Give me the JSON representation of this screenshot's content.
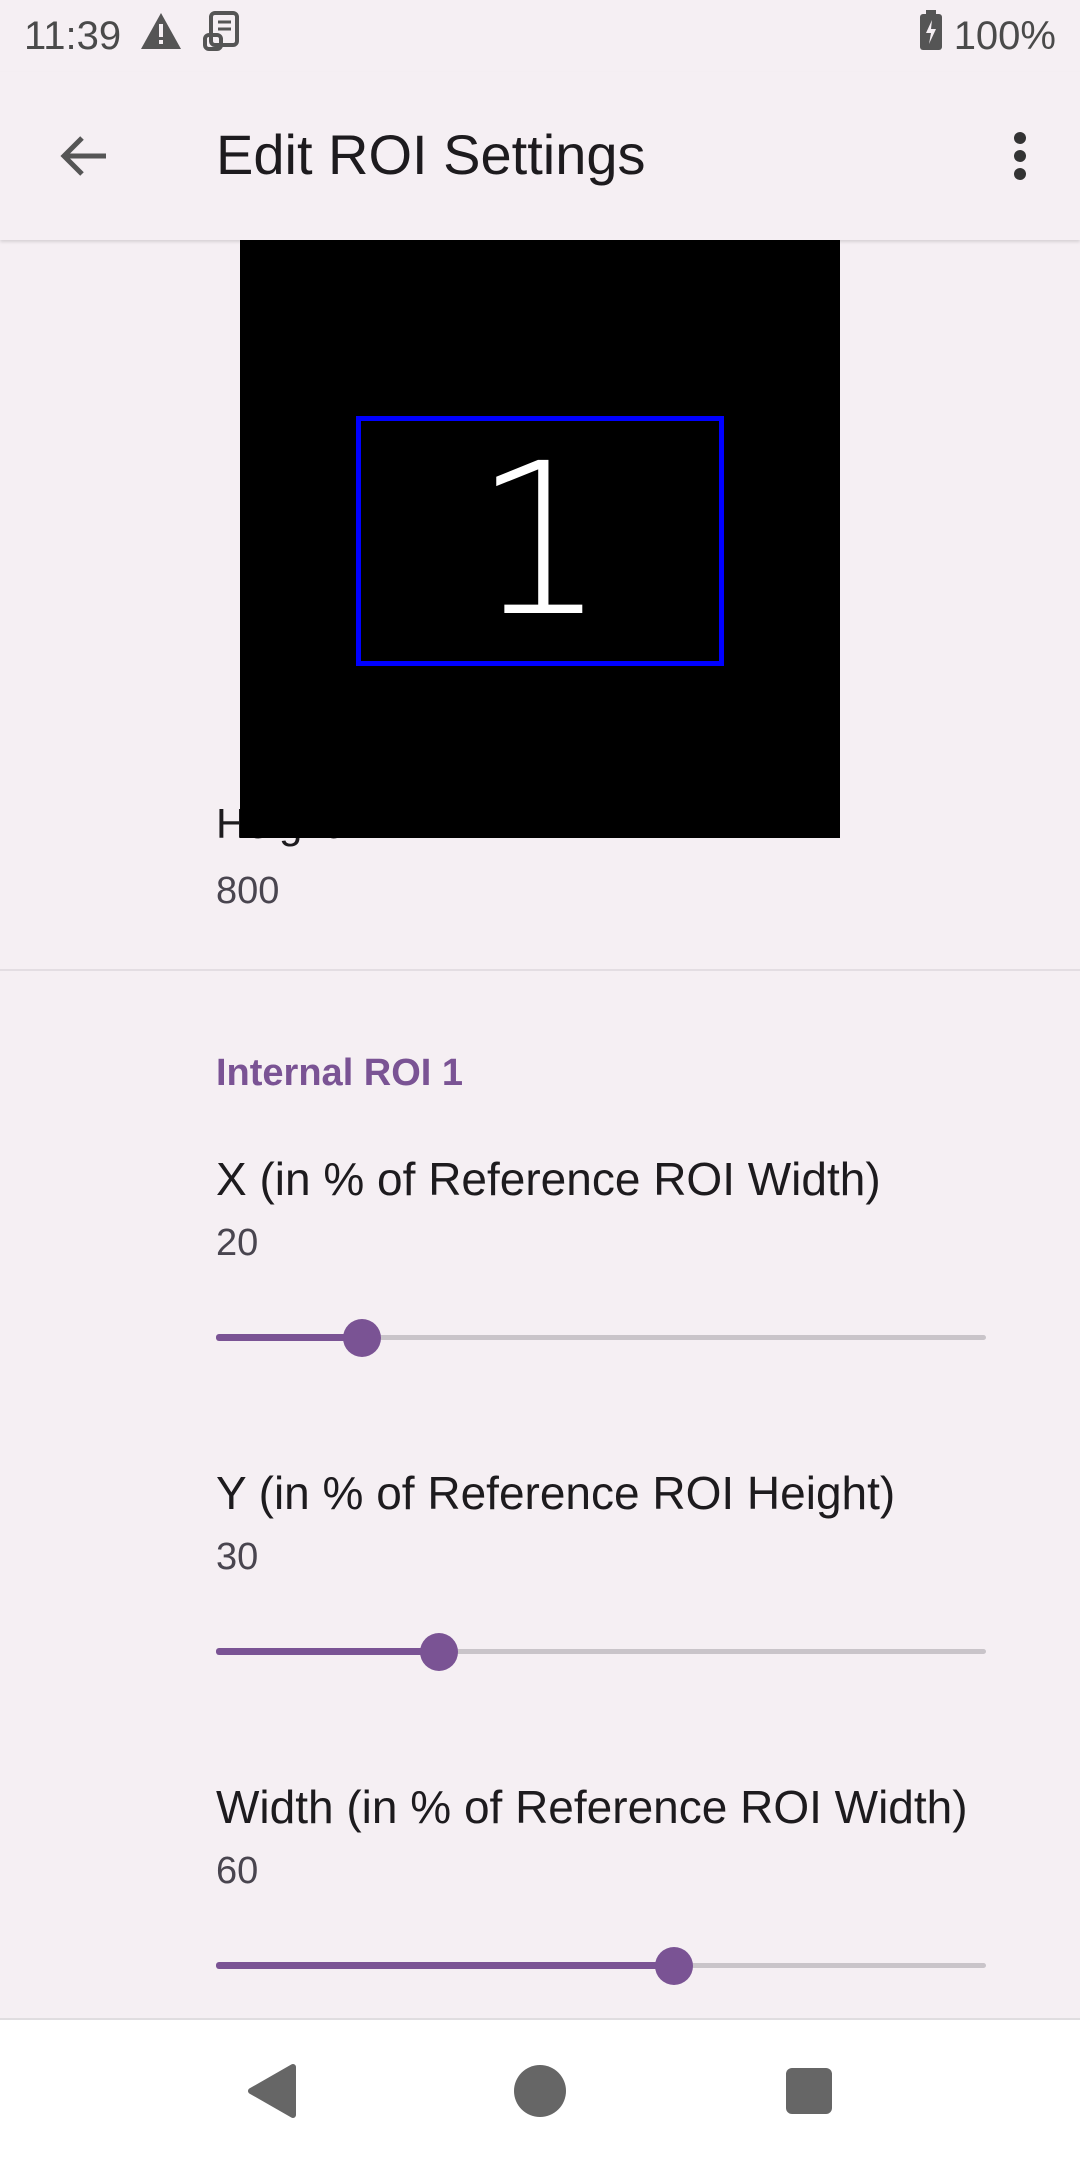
{
  "status_bar": {
    "time": "11:39",
    "notification_icons": [
      "warning-icon",
      "scroll-icon"
    ],
    "battery_icon": "battery-charging-icon",
    "battery_percent": "100%"
  },
  "app_bar": {
    "title": "Edit ROI Settings",
    "back_icon": "arrow-back-icon",
    "overflow_icon": "more-vert-icon"
  },
  "preview": {
    "roi_label": "1",
    "background_color": "#000000",
    "roi_border_color": "#0000ff"
  },
  "height_pref": {
    "title": "Height",
    "value": "800"
  },
  "category": {
    "title": "Internal ROI 1"
  },
  "sliders": [
    {
      "title": "X (in % of Reference ROI Width)",
      "value": "20",
      "fraction": 0.19
    },
    {
      "title": "Y (in % of Reference ROI Height)",
      "value": "30",
      "fraction": 0.29
    },
    {
      "title": "Width (in % of Reference ROI Width)",
      "value": "60",
      "fraction": 0.595
    }
  ],
  "nav_bar": {
    "back_icon": "nav-back-icon",
    "home_icon": "nav-home-icon",
    "recents_icon": "nav-recents-icon"
  },
  "colors": {
    "accent": "#7a5394",
    "background": "#f5eff3"
  }
}
